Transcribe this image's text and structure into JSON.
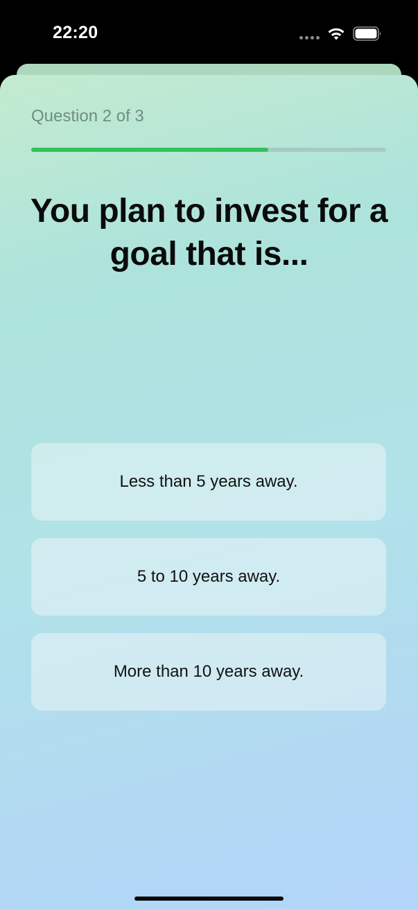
{
  "status_bar": {
    "time": "22:20"
  },
  "quiz": {
    "counter": "Question 2 of 3",
    "progress": 0.667,
    "question": "You plan to invest for a goal that is...",
    "options": [
      {
        "label": "Less than 5 years away."
      },
      {
        "label": "5 to 10 years away."
      },
      {
        "label": "More than 10 years away."
      }
    ]
  },
  "colors": {
    "progress_fill": "#32c35a",
    "progress_track": "#a7cbc4",
    "gradient_top": "#c3ebcf",
    "gradient_bottom": "#b3d5fb"
  },
  "icons": {
    "signal": "signal-icon",
    "wifi": "wifi-icon",
    "battery": "battery-icon"
  }
}
